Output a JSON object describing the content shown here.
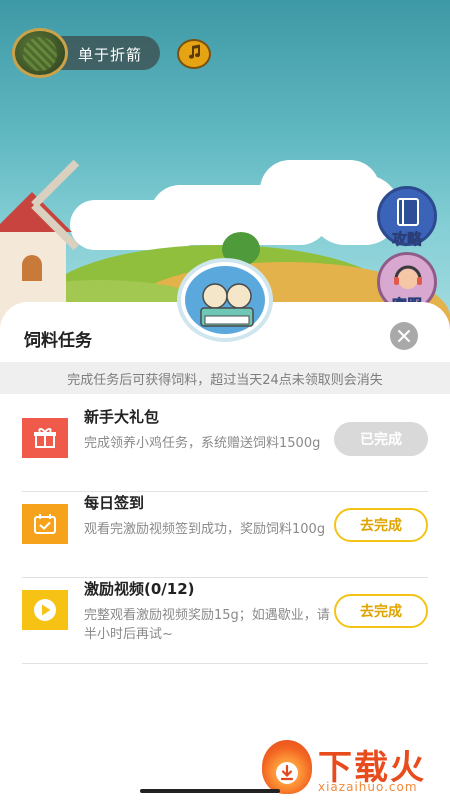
{
  "header": {
    "username": "单于折箭",
    "avatar_icon": "avatar-photo",
    "music_icon": "music-note-icon"
  },
  "side_buttons": [
    {
      "label": "攻略",
      "icon": "book-icon"
    },
    {
      "label": "客服",
      "icon": "headset-icon"
    }
  ],
  "sheet": {
    "title": "饲料任务",
    "notice": "完成任务后可获得饲料，超过当天24点未领取则会消失",
    "tasks": [
      {
        "title": "新手大礼包",
        "desc": "完成领养小鸡任务，系统赠送饲料1500g",
        "button": "已完成",
        "status": "done",
        "icon": "gift-icon",
        "icon_color": "#f05a4a"
      },
      {
        "title": "每日签到",
        "desc": "观看完激励视频签到成功，奖励饲料100g",
        "button": "去完成",
        "status": "todo",
        "icon": "calendar-check-icon",
        "icon_color": "#f7a21b"
      },
      {
        "title": "激励视频(0/12)",
        "desc": "完整观看激励视频奖励15g；如遇歇业，请半小时后再试~",
        "button": "去完成",
        "status": "todo",
        "icon": "play-icon",
        "icon_color": "#f6c315"
      }
    ]
  },
  "watermark": {
    "brand": "下载火",
    "url": "xiazaihuo.com"
  },
  "colors": {
    "accent": "#f3c316",
    "done_button": "#d9d9d9",
    "watermark": "#e84c1c"
  }
}
